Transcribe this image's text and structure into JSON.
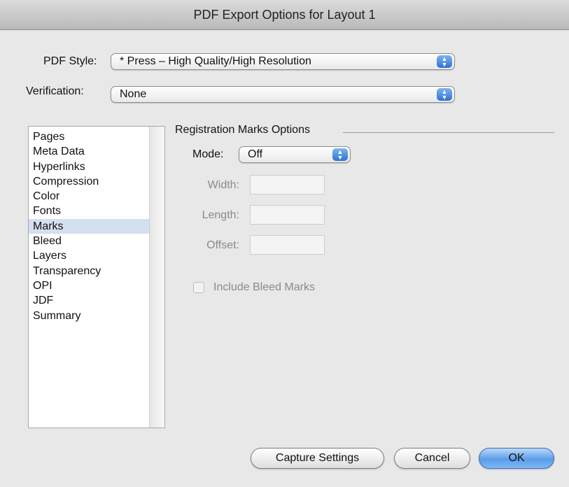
{
  "window": {
    "title": "PDF Export Options for Layout 1"
  },
  "pdf_style": {
    "label": "PDF Style:",
    "value": "* Press – High Quality/High Resolution"
  },
  "verification": {
    "label": "Verification:",
    "value": "None"
  },
  "category_list": {
    "items": [
      "Pages",
      "Meta Data",
      "Hyperlinks",
      "Compression",
      "Color",
      "Fonts",
      "Marks",
      "Bleed",
      "Layers",
      "Transparency",
      "OPI",
      "JDF",
      "Summary"
    ],
    "selected": "Marks"
  },
  "registration_marks": {
    "group_title": "Registration Marks Options",
    "mode_label": "Mode:",
    "mode_value": "Off",
    "width_label": "Width:",
    "width_value": "",
    "length_label": "Length:",
    "length_value": "",
    "offset_label": "Offset:",
    "offset_value": "",
    "include_bleed_label": "Include Bleed Marks",
    "include_bleed_checked": false
  },
  "buttons": {
    "capture": "Capture Settings",
    "cancel": "Cancel",
    "ok": "OK"
  },
  "colors": {
    "accent": "#2d73d6",
    "selection": "#d4dff0"
  }
}
